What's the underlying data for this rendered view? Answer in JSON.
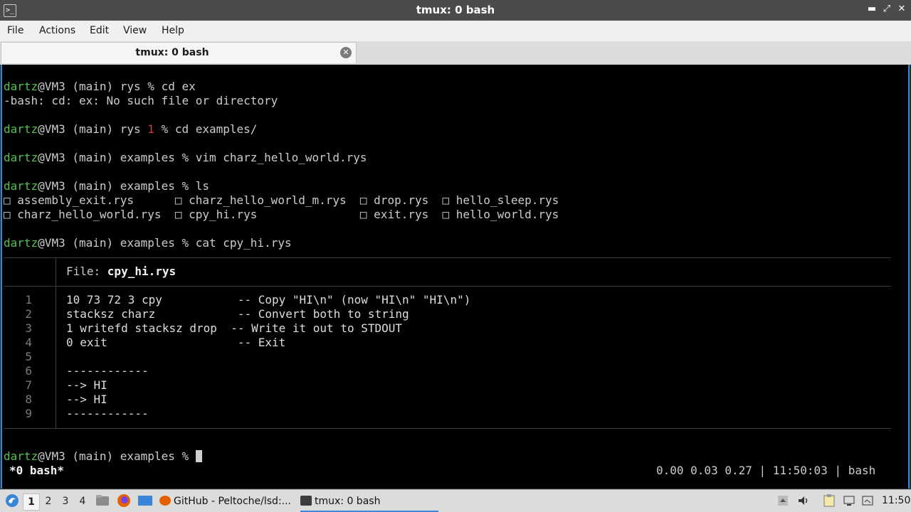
{
  "window": {
    "title": "tmux: 0 bash",
    "buttons": {
      "minimize": "▬",
      "restore": "⤢",
      "close": "✕"
    }
  },
  "menu": {
    "items": [
      "File",
      "Actions",
      "Edit",
      "View",
      "Help"
    ]
  },
  "tab": {
    "label": "tmux: 0 bash",
    "close": "✕"
  },
  "terminal": {
    "prompt_user": "dartz",
    "prompt_host": "@VM3 (main) ",
    "lines": {
      "cmd1": {
        "dir": "rys % ",
        "cmd": "cd ex"
      },
      "err1": "-bash: cd: ex: No such file or directory",
      "cmd2": {
        "dir": "rys ",
        "code": "1",
        "rest": " % cd examples/"
      },
      "cmd3": {
        "dir": "examples % ",
        "cmd": "vim charz_hello_world.rys"
      },
      "cmd4": {
        "dir": "examples % ",
        "cmd": "ls"
      },
      "ls_row1": "□ assembly_exit.rys      □ charz_hello_world_m.rys  □ drop.rys  □ hello_sleep.rys",
      "ls_row2": "□ charz_hello_world.rys  □ cpy_hi.rys               □ exit.rys  □ hello_world.rys",
      "cmd5": {
        "dir": "examples % ",
        "cmd": "cat cpy_hi.rys"
      },
      "cmd6": {
        "dir": "examples % "
      }
    },
    "bat": {
      "file_label": "File: ",
      "file_name": "cpy_hi.rys",
      "line_numbers": [
        "1",
        "2",
        "3",
        "4",
        "5",
        "6",
        "7",
        "8",
        "9"
      ],
      "code": [
        "10 73 72 3 cpy           -- Copy \"HI\\n\" (now \"HI\\n\" \"HI\\n\")",
        "stacksz charz            -- Convert both to string",
        "1 writefd stacksz drop  -- Write it out to STDOUT",
        "0 exit                   -- Exit",
        "",
        "------------",
        "--> HI",
        "--> HI",
        "------------"
      ]
    },
    "status": {
      "left": "*0 bash*",
      "right": "0.00 0.03 0.27 | 11:50:03 | bash"
    }
  },
  "taskbar": {
    "workspaces": [
      "1",
      "2",
      "3",
      "4"
    ],
    "tasks": [
      {
        "label": "GitHub - Peltoche/lsd:..."
      },
      {
        "label": "tmux: 0 bash"
      }
    ],
    "clock": "11:50",
    "colors": {
      "accent": "#3a86d6",
      "prompt_green": "#4fc24f",
      "error_red": "#d23b3b"
    }
  }
}
